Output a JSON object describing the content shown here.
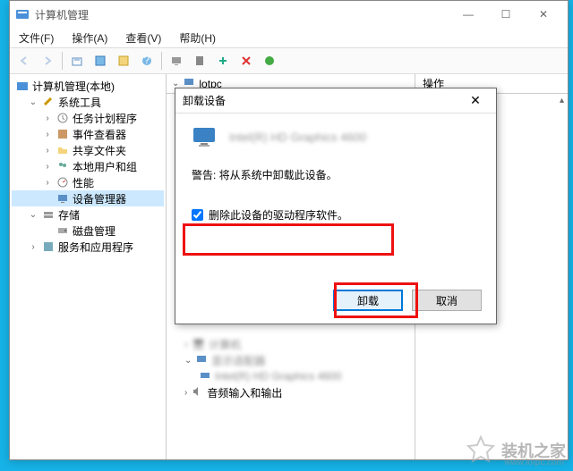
{
  "window": {
    "title": "计算机管理",
    "controls": {
      "min": "—",
      "max": "☐",
      "close": "✕"
    }
  },
  "menu": {
    "file": "文件(F)",
    "action": "操作(A)",
    "view": "查看(V)",
    "help": "帮助(H)"
  },
  "tree": {
    "root": "计算机管理(本地)",
    "system_tools": "系统工具",
    "task_scheduler": "任务计划程序",
    "event_viewer": "事件查看器",
    "shared_folders": "共享文件夹",
    "local_users": "本地用户和组",
    "performance": "性能",
    "device_manager": "设备管理器",
    "storage": "存储",
    "disk_mgmt": "磁盘管理",
    "services_apps": "服务和应用程序"
  },
  "mid": {
    "header": "lotpc",
    "rows": {
      "r1": "计算机",
      "r2": "显示适配器",
      "r3": "Intel(R) HD Graphics 4600",
      "r4": "音频输入和输出"
    }
  },
  "right": {
    "header": "操作"
  },
  "dialog": {
    "title": "卸载设备",
    "device": "Intel(R) HD Graphics 4600",
    "warning": "警告: 将从系统中卸载此设备。",
    "checkbox": "删除此设备的驱动程序软件。",
    "checked": true,
    "uninstall": "卸载",
    "cancel": "取消"
  },
  "watermark": {
    "text": "装机之家",
    "url": "www.lotpc.com"
  }
}
